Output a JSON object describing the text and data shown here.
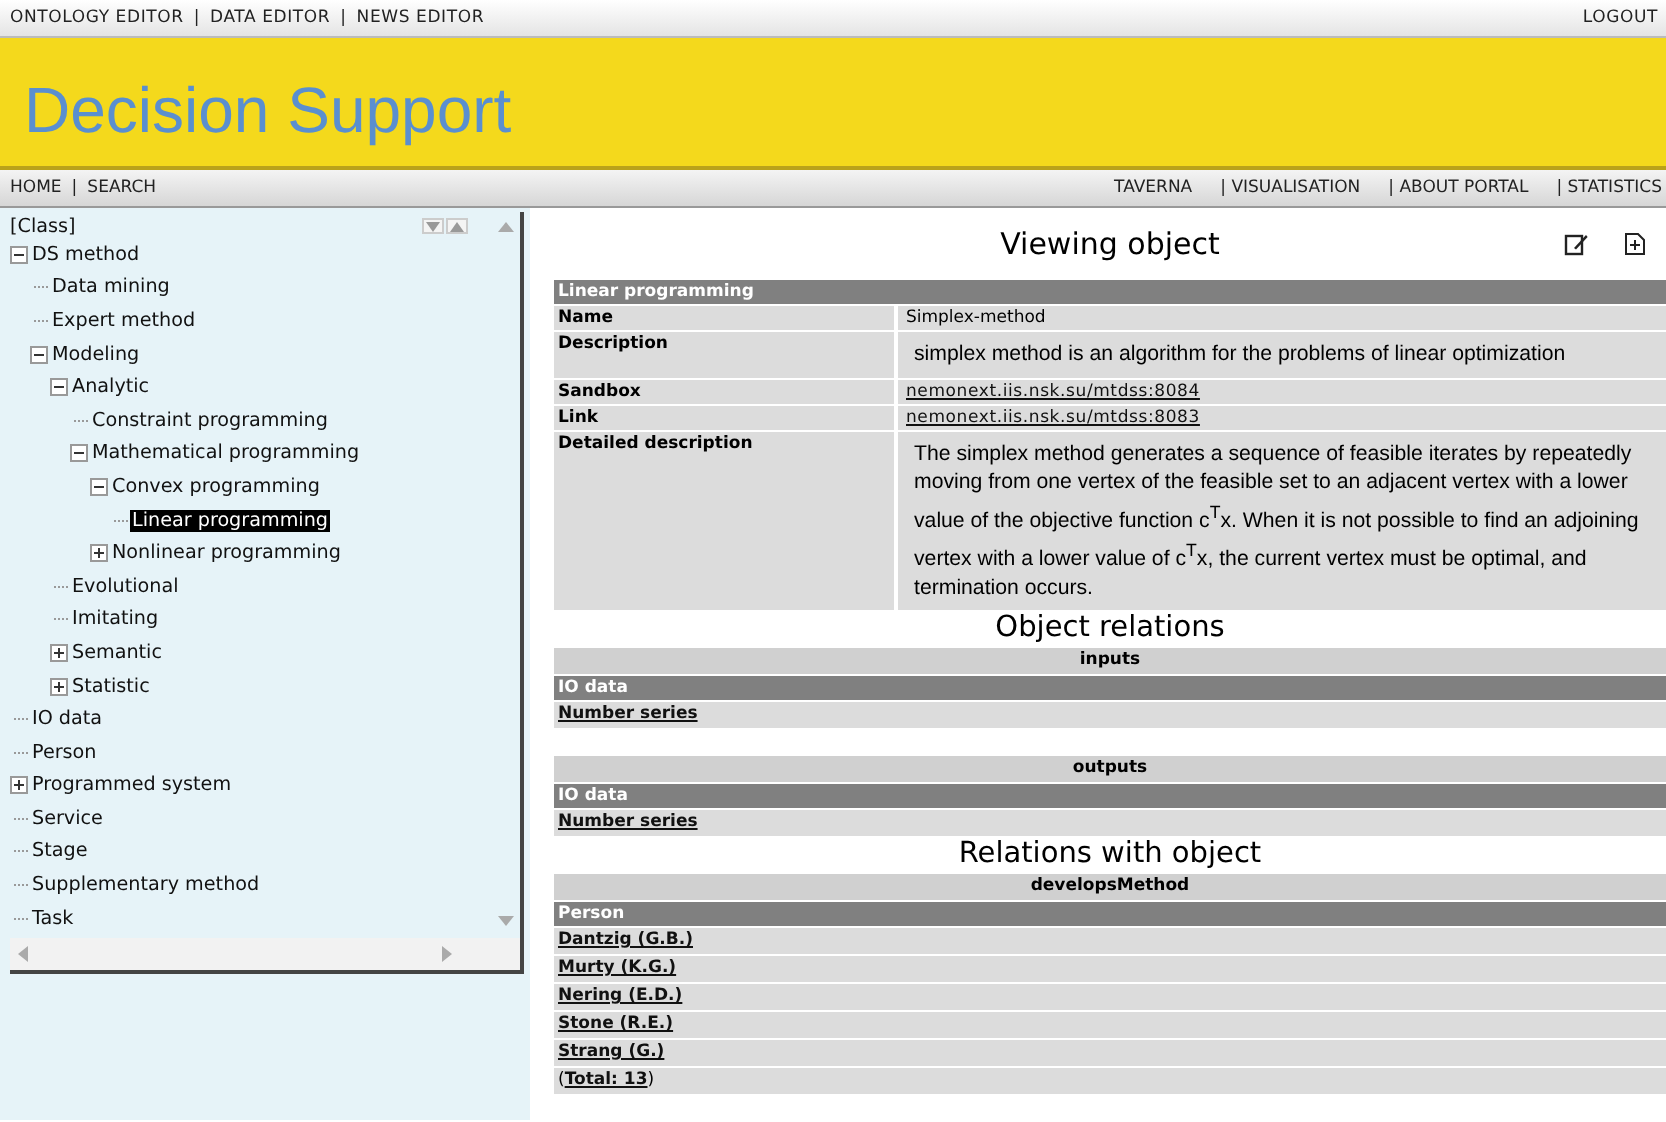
{
  "top_bar": {
    "links": [
      "ONTOLOGY EDITOR",
      "DATA EDITOR",
      "NEWS EDITOR"
    ],
    "separator": "|",
    "logout": "LOGOUT"
  },
  "banner": {
    "title": "Decision Support"
  },
  "nav": {
    "left": [
      "HOME",
      "SEARCH"
    ],
    "separator": "|",
    "right": [
      "TAVERNA",
      "| VISUALISATION",
      "| ABOUT PORTAL",
      "| STATISTICS"
    ]
  },
  "tree": {
    "root_label": "[Class]",
    "nodes": [
      {
        "label": "DS method",
        "selected": false,
        "expanded": true,
        "children": [
          {
            "label": "Data mining",
            "selected": false
          },
          {
            "label": "Expert method",
            "selected": false
          },
          {
            "label": "Modeling",
            "selected": false,
            "expanded": true,
            "children": [
              {
                "label": "Analytic",
                "selected": false,
                "expanded": true,
                "children": [
                  {
                    "label": "Constraint programming",
                    "selected": false
                  },
                  {
                    "label": "Mathematical programming",
                    "selected": false,
                    "expanded": true,
                    "children": [
                      {
                        "label": "Convex programming",
                        "selected": false,
                        "expanded": true,
                        "children": [
                          {
                            "label": "Linear programming",
                            "selected": true
                          }
                        ]
                      },
                      {
                        "label": "Nonlinear programming",
                        "selected": false,
                        "expanded": false
                      }
                    ]
                  }
                ]
              },
              {
                "label": "Evolutional",
                "selected": false
              },
              {
                "label": "Imitating",
                "selected": false
              },
              {
                "label": "Semantic",
                "selected": false,
                "expanded": false
              },
              {
                "label": "Statistic",
                "selected": false,
                "expanded": false
              }
            ]
          }
        ]
      },
      {
        "label": "IO data",
        "selected": false
      },
      {
        "label": "Person",
        "selected": false
      },
      {
        "label": "Programmed system",
        "selected": false,
        "expanded": false
      },
      {
        "label": "Service",
        "selected": false
      },
      {
        "label": "Stage",
        "selected": false
      },
      {
        "label": "Supplementary method",
        "selected": false
      },
      {
        "label": "Task",
        "selected": false
      }
    ]
  },
  "object": {
    "title": "Viewing object",
    "class_name": "Linear programming",
    "fields": [
      {
        "label": "Name",
        "value": "Simplex-method",
        "kind": "text"
      },
      {
        "label": "Description",
        "value": "simplex method  is an algorithm for the problems of linear optimization",
        "kind": "paragraph"
      },
      {
        "label": "Sandbox",
        "value": "nemonext.iis.nsk.su/mtdss:8084",
        "kind": "link"
      },
      {
        "label": "Link",
        "value": "nemonext.iis.nsk.su/mtdss:8083",
        "kind": "link"
      },
      {
        "label": "Detailed description",
        "value": "The simplex method generates a sequence of feasible iterates by repeatedly moving from one vertex of the feasible set to an adjacent vertex with a lower value of the objective function c$^{T}$x. When it is not possible to find an adjoining vertex with a lower value of c$^{T}$x, the current vertex must be optimal, and termination occurs.",
        "kind": "paragraph"
      }
    ]
  },
  "object_relations": {
    "title": "Object relations",
    "groups": [
      {
        "name": "inputs",
        "class": "IO data",
        "items": [
          "Number series"
        ]
      },
      {
        "name": "outputs",
        "class": "IO data",
        "items": [
          "Number series"
        ]
      }
    ]
  },
  "relations_with_object": {
    "title": "Relations with object",
    "groups": [
      {
        "name": "developsMethod",
        "class": "Person",
        "items": [
          "Dantzig (G.B.)",
          "Murty (K.G.)",
          "Nering (E.D.)",
          "Stone (R.E.)",
          "Strang (G.)"
        ],
        "total": {
          "before": "(",
          "link": "Total: 13",
          "after": ")"
        }
      }
    ]
  }
}
